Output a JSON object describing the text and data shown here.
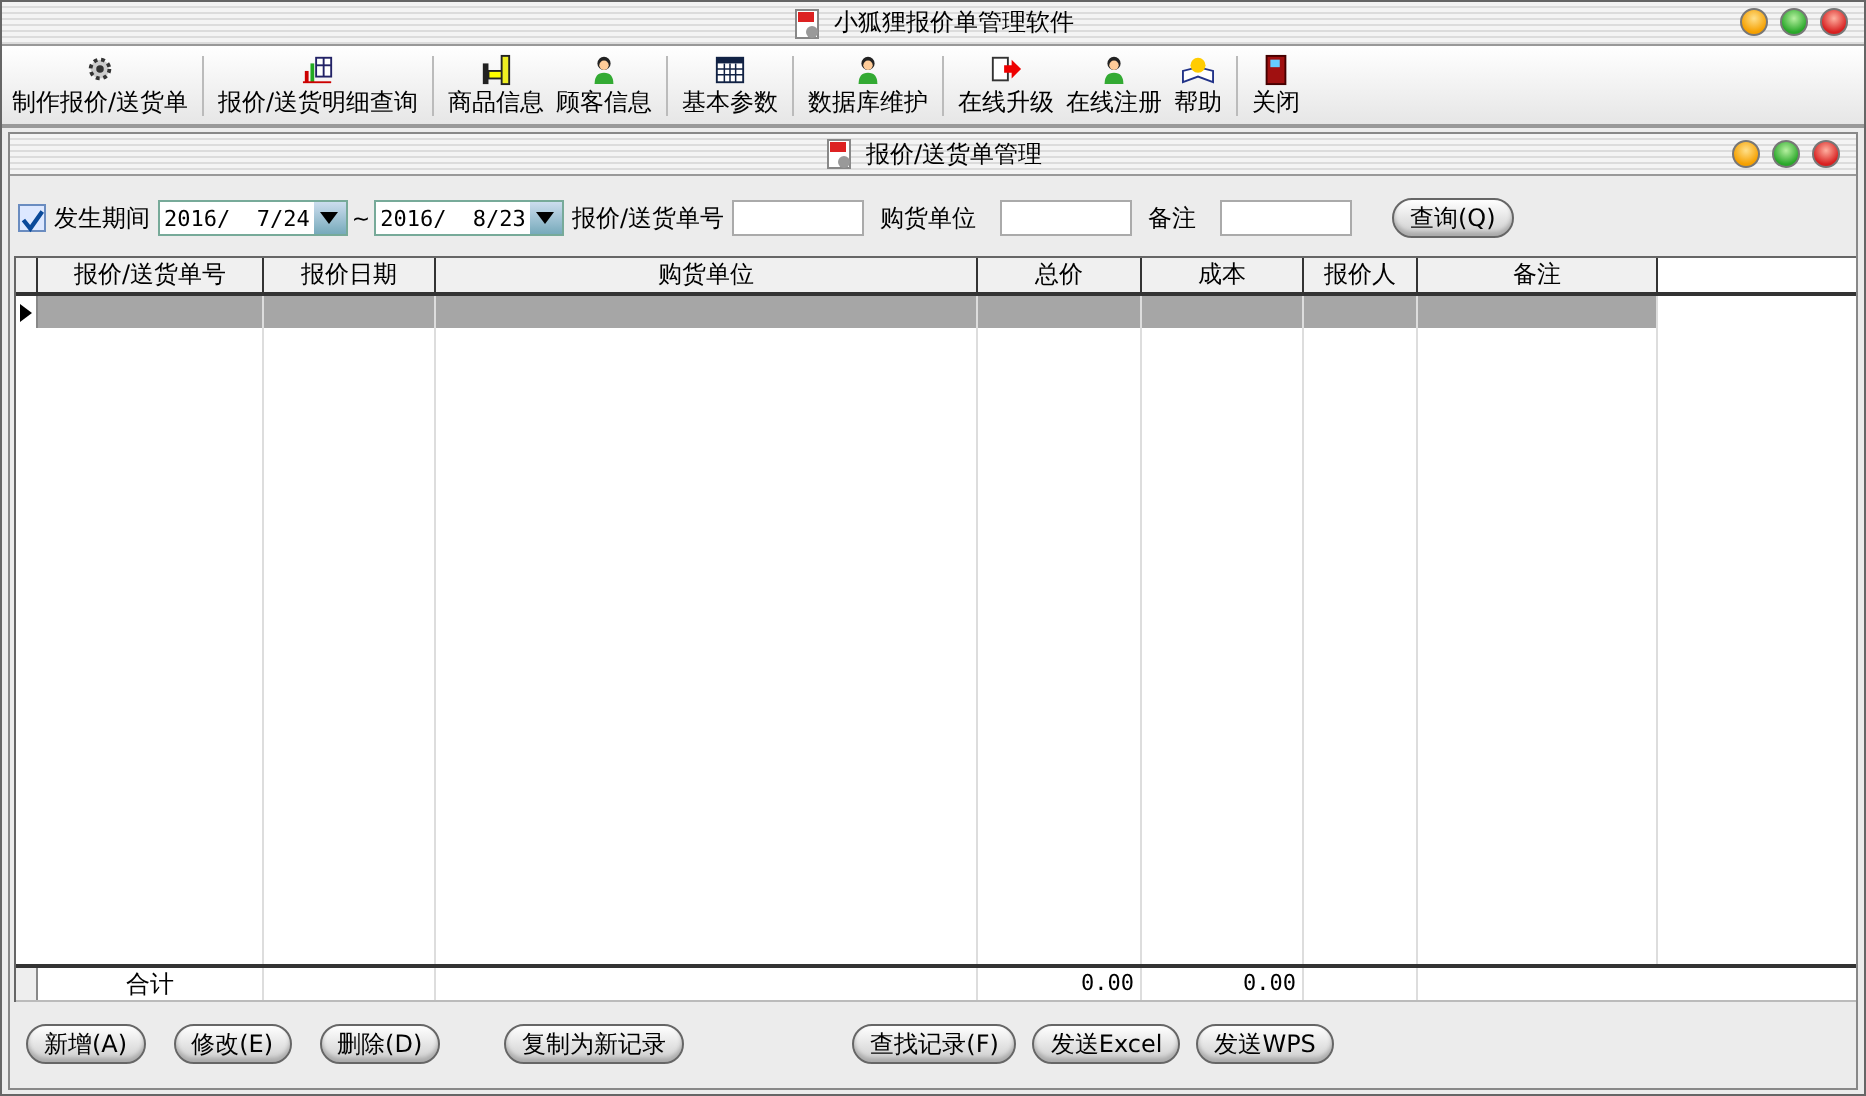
{
  "window": {
    "title": "小狐狸报价单管理软件"
  },
  "toolbar_groups": [
    {
      "items": [
        {
          "label": "制作报价/送货单"
        }
      ]
    },
    {
      "items": [
        {
          "label": "报价/送货明细查询"
        }
      ]
    },
    {
      "items": [
        {
          "label": "商品信息"
        },
        {
          "label": "顾客信息"
        }
      ]
    },
    {
      "items": [
        {
          "label": "基本参数"
        }
      ]
    },
    {
      "items": [
        {
          "label": "数据库维护"
        }
      ]
    },
    {
      "items": [
        {
          "label": "在线升级"
        },
        {
          "label": "在线注册"
        },
        {
          "label": "帮助"
        }
      ]
    },
    {
      "items": [
        {
          "label": "关闭"
        }
      ]
    }
  ],
  "subwindow": {
    "title": "报价/送货单管理"
  },
  "filter": {
    "period_label": "发生期间",
    "checked": true,
    "date_from": "2016/  7/24",
    "separator": "~",
    "date_to": "2016/  8/23",
    "fields": [
      {
        "label": "报价/送货单号"
      },
      {
        "label": "购货单位"
      },
      {
        "label": "备注"
      }
    ],
    "search_button": "查询(Q)"
  },
  "table": {
    "columns": [
      "报价/送货单号",
      "报价日期",
      "购货单位",
      "总价",
      "成本",
      "报价人",
      "备注"
    ],
    "rows": [
      {
        "selected": true
      }
    ],
    "totals": {
      "label": "合计",
      "total_price": "0.00",
      "cost": "0.00"
    }
  },
  "buttons": [
    {
      "label": "新增(A)"
    },
    {
      "label": "修改(E)"
    },
    {
      "label": "删除(D)"
    },
    {
      "label": "复制为新记录"
    },
    {
      "label": "查找记录(F)"
    },
    {
      "label": "发送Excel"
    },
    {
      "label": "发送WPS"
    }
  ]
}
